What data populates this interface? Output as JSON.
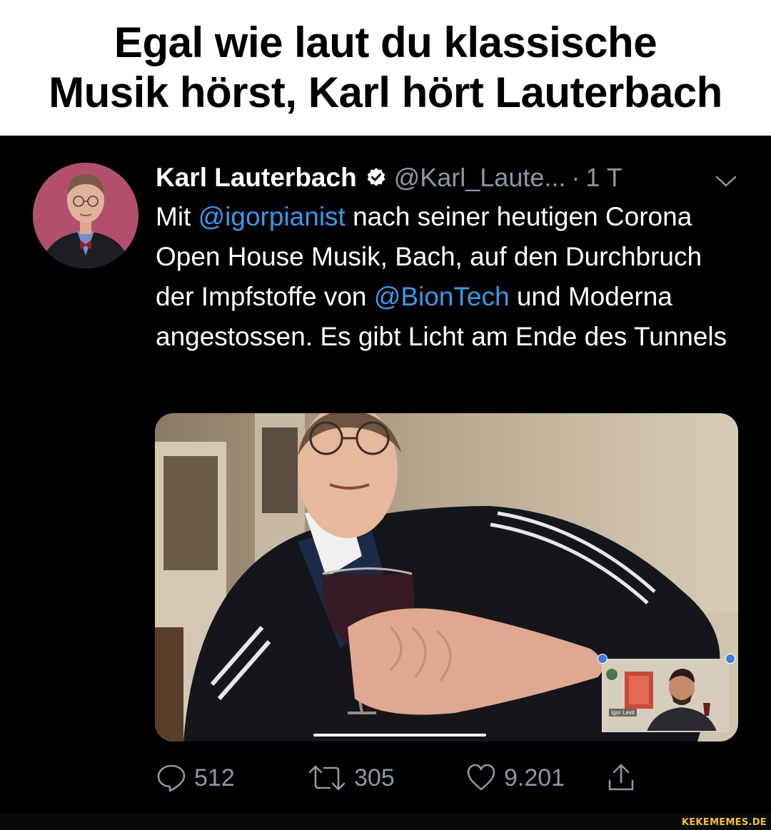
{
  "caption": {
    "line1": "Egal wie laut du klassische",
    "line2": "Musik hörst, Karl hört Lauterbach"
  },
  "tweet": {
    "display_name": "Karl Lauterbach",
    "handle": "@Karl_Laute...",
    "separator": "·",
    "time": "1 T",
    "text": {
      "p1": "Mit ",
      "mention1": "@igorpianist",
      "p2": " nach seiner heutigen Corona Open House Musik, Bach, auf den Durchbruch der Impfstoffe von ",
      "mention2": "@BionTech",
      "p3": " und Moderna angestossen. Es gibt Licht am Ende des Tunnels"
    },
    "media": {
      "pip_label": "Igor Levit"
    },
    "actions": {
      "replies": "512",
      "retweets": "305",
      "likes": "9.201"
    }
  },
  "icons": {
    "verified": "verified-badge-icon",
    "chevron": "chevron-down-icon",
    "reply": "reply-icon",
    "retweet": "retweet-icon",
    "like": "heart-icon",
    "share": "share-icon"
  },
  "colors": {
    "background": "#000000",
    "link": "#3b98e8",
    "muted": "#8b98a5",
    "watermark": "#f2c230"
  },
  "watermark": "KEKEMEMES.DE"
}
